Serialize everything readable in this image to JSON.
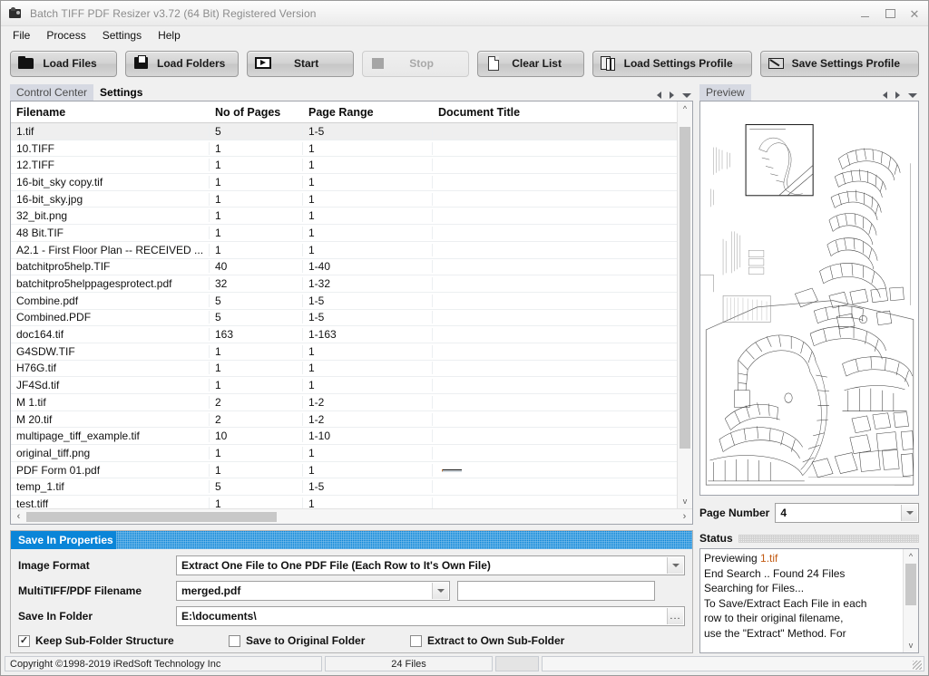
{
  "window": {
    "title": "Batch TIFF PDF Resizer v3.72 (64 Bit)  Registered Version",
    "app_icon": "camera-icon",
    "minimize_label": "",
    "maximize_label": "",
    "close_label": "✕"
  },
  "menu": {
    "items": [
      {
        "label": "File"
      },
      {
        "label": "Process"
      },
      {
        "label": "Settings"
      },
      {
        "label": "Help"
      }
    ]
  },
  "toolbar": {
    "buttons": [
      {
        "label": "Load Files",
        "icon": "folder-icon",
        "disabled": false
      },
      {
        "label": "Load Folders",
        "icon": "folders-icon",
        "disabled": false
      },
      {
        "label": "Start",
        "icon": "play-icon",
        "disabled": false
      },
      {
        "label": "Stop",
        "icon": "stop-icon",
        "disabled": true
      },
      {
        "label": "Clear List",
        "icon": "page-icon",
        "disabled": false
      },
      {
        "label": "Load Settings Profile",
        "icon": "load-profile-icon",
        "disabled": false
      },
      {
        "label": "Save Settings Profile",
        "icon": "save-profile-icon",
        "disabled": false
      }
    ]
  },
  "tabs": {
    "items": [
      {
        "label": "Control Center",
        "active": false
      },
      {
        "label": "Settings",
        "active": true
      }
    ],
    "nav": {
      "prev": "left-arrow-icon",
      "next": "right-arrow-icon",
      "menu": "chevron-down-icon"
    }
  },
  "file_table": {
    "columns": [
      "Filename",
      "No of Pages",
      "Page Range",
      "Document Title"
    ],
    "rows": [
      {
        "filename": "1.tif",
        "pages": "5",
        "range": "1-5",
        "title": "",
        "selected": true
      },
      {
        "filename": "10.TIFF",
        "pages": "1",
        "range": "1",
        "title": "",
        "selected": false
      },
      {
        "filename": "12.TIFF",
        "pages": "1",
        "range": "1",
        "title": "",
        "selected": false
      },
      {
        "filename": "16-bit_sky copy.tif",
        "pages": "1",
        "range": "1",
        "title": "",
        "selected": false
      },
      {
        "filename": "16-bit_sky.jpg",
        "pages": "1",
        "range": "1",
        "title": "",
        "selected": false
      },
      {
        "filename": "32_bit.png",
        "pages": "1",
        "range": "1",
        "title": "",
        "selected": false
      },
      {
        "filename": "48 Bit.TIF",
        "pages": "1",
        "range": "1",
        "title": "",
        "selected": false
      },
      {
        "filename": "A2.1 - First Floor Plan -- RECEIVED ...",
        "pages": "1",
        "range": "1",
        "title": "",
        "selected": false
      },
      {
        "filename": "batchitpro5help.TIF",
        "pages": "40",
        "range": "1-40",
        "title": "",
        "selected": false
      },
      {
        "filename": "batchitpro5helppagesprotect.pdf",
        "pages": "32",
        "range": "1-32",
        "title": "",
        "selected": false
      },
      {
        "filename": "Combine.pdf",
        "pages": "5",
        "range": "1-5",
        "title": "",
        "selected": false
      },
      {
        "filename": "Combined.PDF",
        "pages": "5",
        "range": "1-5",
        "title": "",
        "selected": false
      },
      {
        "filename": "doc164.tif",
        "pages": "163",
        "range": "1-163",
        "title": "",
        "selected": false
      },
      {
        "filename": "G4SDW.TIF",
        "pages": "1",
        "range": "1",
        "title": "",
        "selected": false
      },
      {
        "filename": "H76G.tif",
        "pages": "1",
        "range": "1",
        "title": "",
        "selected": false
      },
      {
        "filename": "JF4Sd.tif",
        "pages": "1",
        "range": "1",
        "title": "",
        "selected": false
      },
      {
        "filename": "M 1.tif",
        "pages": "2",
        "range": "1-2",
        "title": "",
        "selected": false
      },
      {
        "filename": "M 20.tif",
        "pages": "2",
        "range": "1-2",
        "title": "",
        "selected": false
      },
      {
        "filename": "multipage_tiff_example.tif",
        "pages": "10",
        "range": "1-10",
        "title": "",
        "selected": false
      },
      {
        "filename": "original_tiff.png",
        "pages": "1",
        "range": "1",
        "title": "",
        "selected": false
      },
      {
        "filename": "PDF Form 01.pdf",
        "pages": "1",
        "range": "1",
        "title": "",
        "selected": false,
        "editing": true
      },
      {
        "filename": "temp_1.tif",
        "pages": "5",
        "range": "1-5",
        "title": "",
        "selected": false
      }
    ]
  },
  "preview": {
    "tab_label": "Preview",
    "page_number_label": "Page Number",
    "page_number_value": "4",
    "nav": {
      "prev": "left-arrow-icon",
      "next": "right-arrow-icon",
      "menu": "chevron-down-icon"
    }
  },
  "save_in_properties": {
    "header": "Save In Properties",
    "image_format_label": "Image Format",
    "image_format_value": "Extract One File to One PDF File (Each Row to It's Own File)",
    "multitiff_label": "MultiTIFF/PDF Filename",
    "multitiff_value": "merged.pdf",
    "extra_field_value": "",
    "save_in_folder_label": "Save In Folder",
    "save_in_folder_value": "E:\\documents\\",
    "browse_button_label": "...",
    "checkboxes": [
      {
        "label": "Keep Sub-Folder Structure",
        "checked": true
      },
      {
        "label": "Save to Original Folder",
        "checked": false
      },
      {
        "label": "Extract to Own Sub-Folder",
        "checked": false
      }
    ]
  },
  "status": {
    "title": "Status",
    "lines": [
      {
        "text": "Previewing ",
        "highlight": "1.tif"
      },
      {
        "text": "End Search .. Found 24 Files",
        "highlight": ""
      },
      {
        "text": "Searching for Files...",
        "highlight": ""
      },
      {
        "text": "To Save/Extract Each File in each",
        "highlight": ""
      },
      {
        "text": "row to their original filename,",
        "highlight": ""
      },
      {
        "text": "use the \"Extract\" Method. For",
        "highlight": ""
      }
    ]
  },
  "statusbar": {
    "copyright": "Copyright ©1998-2019 iRedSoft Technology Inc",
    "file_count": "24 Files",
    "extra": "",
    "progress": ""
  },
  "colors": {
    "accent_blue": "#0a85d8",
    "window_bg": "#f0f0f0",
    "panel_border": "#9fa3ab",
    "selected_row": "#efefef",
    "highlight_text": "#c25a12"
  }
}
